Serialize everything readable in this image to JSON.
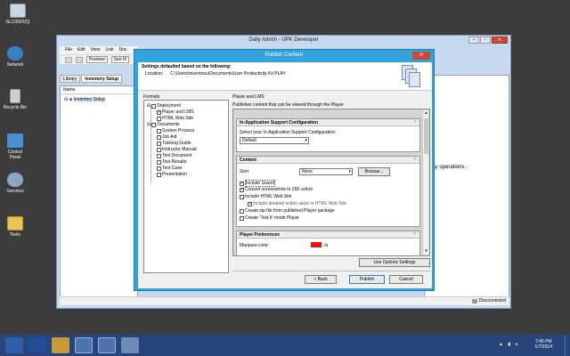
{
  "desktop": {
    "icons": [
      {
        "label": "SLC00DOQ"
      },
      {
        "label": "Network"
      },
      {
        "label": "Recycle Bin"
      },
      {
        "label": "Control Panel"
      },
      {
        "label": "Services"
      },
      {
        "label": "Tools"
      }
    ]
  },
  "app_window": {
    "title": "Daily Admin - UPK Developer",
    "menus": [
      "File",
      "Edit",
      "View",
      "Link",
      "Doc"
    ],
    "toolbar": {
      "preview_label": "Preview",
      "see_label": "See It!"
    },
    "tabs": [
      {
        "label": "Library"
      },
      {
        "label": "Inventory Setup"
      }
    ],
    "column_header": "Name",
    "tree_item": "Inventory Setup",
    "right_text": "day operations.",
    "status": "Disconnected"
  },
  "dialog": {
    "title": "Publish Content",
    "close_label": "✕",
    "header_title": "Settings defaulted based on the following:",
    "location_label": "Location:",
    "location_path": "C:\\Users\\msentosu\\Documents\\User Productivity Kit PLAY",
    "formats_label": "Formats",
    "formats_tree": [
      {
        "label": "Deployment",
        "checked": false
      },
      {
        "label": "Player and LMS",
        "checked": true
      },
      {
        "label": "HTML Web Site",
        "checked": false
      },
      {
        "label": "Documents",
        "checked": false
      },
      {
        "label": "System Process",
        "checked": false
      },
      {
        "label": "Job Aid",
        "checked": false
      },
      {
        "label": "Training Guide",
        "checked": false
      },
      {
        "label": "Instructor Manual",
        "checked": false
      },
      {
        "label": "Test Document",
        "checked": false
      },
      {
        "label": "Test Results",
        "checked": false
      },
      {
        "label": "Test Case",
        "checked": false
      },
      {
        "label": "Presentation",
        "checked": false
      }
    ],
    "panel_label": "Player and LMS",
    "panel_desc": "Publishes content that can be viewed through the Player.",
    "sections": {
      "inapp": {
        "title": "In-Application Support Configuration",
        "select_label": "Select your In-Application Support Configuration:",
        "select_value": "Default"
      },
      "content": {
        "title": "Content",
        "skin_label": "Skin:",
        "skin_value": "None",
        "browse_label": "Browse...",
        "options": [
          {
            "label": "Include Sound",
            "checked": true
          },
          {
            "label": "Convert screenshots to 256 colors",
            "checked": true
          },
          {
            "label": "Include HTML Web Site",
            "checked": false
          },
          {
            "label": "Include detailed action steps in HTML Web Site",
            "checked": true
          },
          {
            "label": "Create zip file from published Player package",
            "checked": false
          },
          {
            "label": "Create 'Test It' mode Player",
            "checked": false
          }
        ]
      },
      "prefs": {
        "title": "Player Preferences",
        "marquee_label": "Marquee color:",
        "marquee_color": "#ee1111",
        "marquee_suffix": "/a"
      }
    },
    "buttons": {
      "use_options": "Use Options Settings",
      "back": "< Back",
      "publish": "Publish",
      "cancel": "Cancel"
    }
  },
  "taskbar": {
    "time": "7:45 PM",
    "date": "1/7/2014"
  },
  "colors": {
    "desktop_bg": "#3c3c3c",
    "dialog_frame": "#33a3db",
    "taskbar_bg": "#27457a"
  }
}
